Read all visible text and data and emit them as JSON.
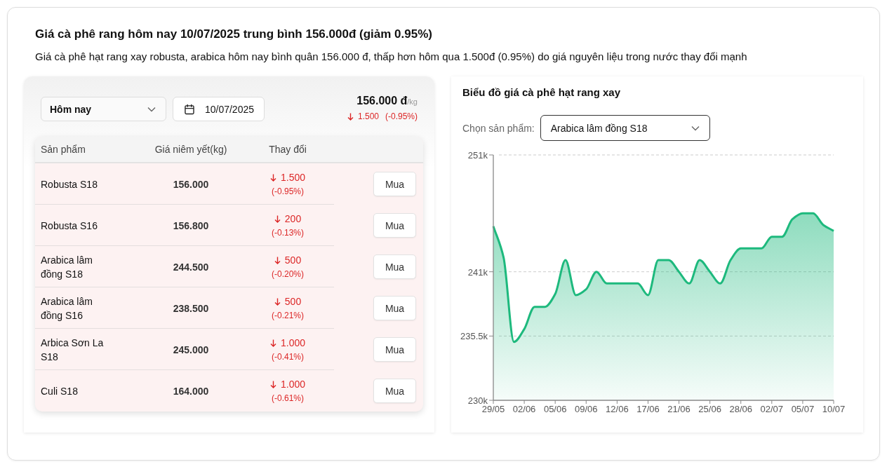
{
  "header": {
    "title": "Giá cà phê rang hôm nay 10/07/2025 trung bình 156.000đ (giảm 0.95%)",
    "subtitle": "Giá cà phê hạt rang xay robusta, arabica hôm nay bình quân 156.000 đ, thấp hơn hôm qua 1.500đ (0.95%) do giá nguyên liệu trong nước thay đổi mạnh"
  },
  "price_panel": {
    "period_select": {
      "value": "Hôm nay"
    },
    "date_field": {
      "value": "10/07/2025"
    },
    "summary": {
      "price": "156.000 đ",
      "unit": "/kg",
      "kind": "down",
      "change": "1.500",
      "percent": "(-0.95%)"
    },
    "table": {
      "columns": [
        "Sản phẩm",
        "Giá niêm yết(kg)",
        "Thay đổi"
      ],
      "rows": [
        {
          "product": "Robusta S18",
          "price": "156.000",
          "kind": "down",
          "change": "1.500",
          "percent": "(-0.95%)",
          "button": "Mua"
        },
        {
          "product": "Robusta S16",
          "price": "156.800",
          "kind": "down",
          "change": "200",
          "percent": "(-0.13%)",
          "button": "Mua"
        },
        {
          "product": "Arabica lâm đồng S18",
          "price": "244.500",
          "kind": "down",
          "change": "500",
          "percent": "(-0.20%)",
          "button": "Mua"
        },
        {
          "product": "Arabica lâm đồng S16",
          "price": "238.500",
          "kind": "down",
          "change": "500",
          "percent": "(-0.21%)",
          "button": "Mua"
        },
        {
          "product": "Arbica Sơn La S18",
          "price": "245.000",
          "kind": "down",
          "change": "1.000",
          "percent": "(-0.41%)",
          "button": "Mua"
        },
        {
          "product": "Culi S18",
          "price": "164.000",
          "kind": "down",
          "change": "1.000",
          "percent": "(-0.61%)",
          "button": "Mua"
        }
      ]
    }
  },
  "chart_panel": {
    "title": "Biểu đồ giá cà phê hạt rang xay",
    "product_select": {
      "label": "Chọn sản phẩm:",
      "value": "Arabica lâm đồng S18"
    },
    "chart_data": {
      "type": "area",
      "categories": [
        "29/05",
        null,
        null,
        "02/06",
        null,
        null,
        "05/06",
        null,
        null,
        "09/06",
        null,
        null,
        "12/06",
        null,
        null,
        "17/06",
        null,
        null,
        "21/06",
        null,
        null,
        "25/06",
        null,
        null,
        "28/06",
        null,
        null,
        "02/07",
        null,
        null,
        "05/07",
        null,
        null,
        "10/07"
      ],
      "series": [
        {
          "color": "#1db97d",
          "values": [
            244.9,
            242.2,
            235.0,
            236.1,
            238.0,
            238.0,
            239.1,
            242.0,
            239.0,
            239.5,
            241.0,
            240.0,
            240.0,
            240.0,
            240.0,
            239.0,
            242.0,
            242.0,
            241.0,
            240.0,
            242.0,
            241.0,
            240.0,
            242.0,
            243.0,
            243.0,
            243.0,
            244.0,
            244.0,
            245.5,
            246.0,
            246.0,
            245.0,
            244.5
          ]
        }
      ],
      "ylim": [
        230,
        251
      ],
      "yticks": [
        {
          "value": 230,
          "label": "230k"
        },
        {
          "value": 235.5,
          "label": "235.5k"
        },
        {
          "value": 241,
          "label": "241k"
        },
        {
          "value": 251,
          "label": "251k"
        }
      ]
    }
  }
}
